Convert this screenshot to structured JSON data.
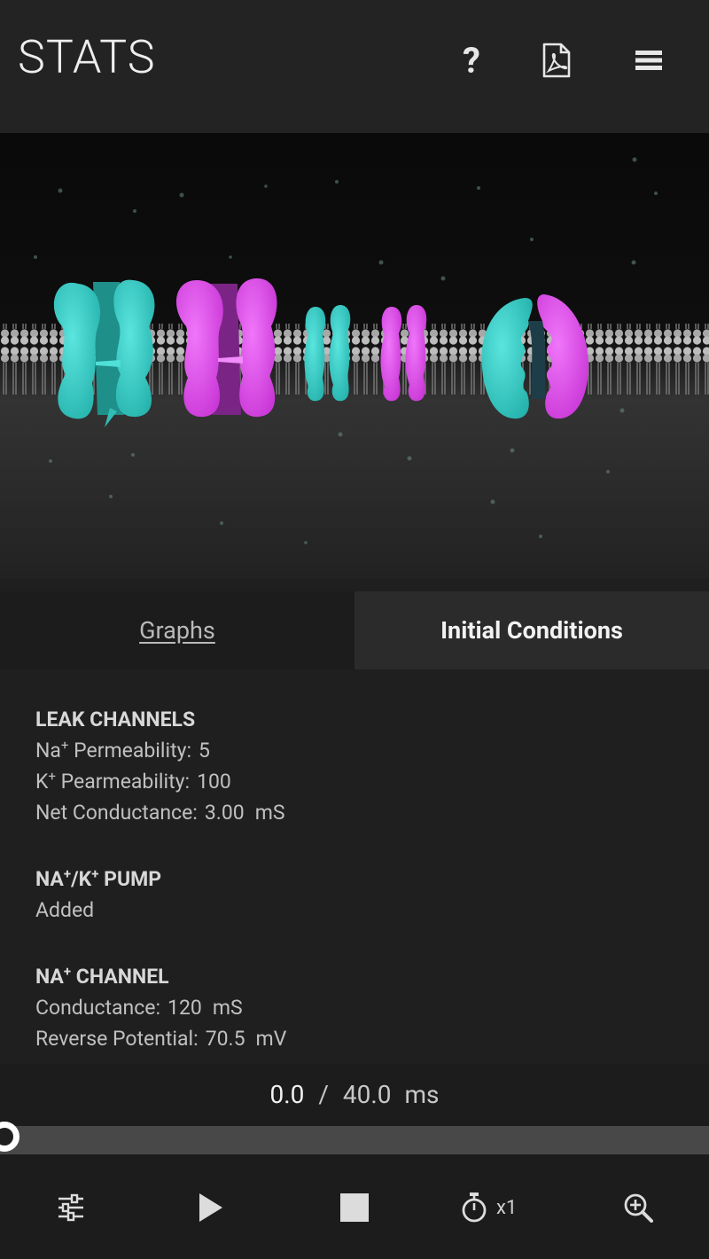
{
  "header": {
    "title": "STATS",
    "help_label": "?",
    "icons": [
      "help-icon",
      "pdf-icon",
      "menu-icon"
    ]
  },
  "tabs": [
    {
      "label": "Graphs",
      "active": false
    },
    {
      "label": "Initial Conditions",
      "active": true
    }
  ],
  "sections": {
    "leak": {
      "title": "LEAK CHANNELS",
      "na_label_pre": "Na",
      "na_label_sup": "+",
      "na_label_post": " Permeability:",
      "na_value": "5",
      "k_label_pre": "K",
      "k_label_sup": "+",
      "k_label_post": " Pearmeability:",
      "k_value": "100",
      "net_label": "Net Conductance:",
      "net_value": "3.00",
      "net_unit": "mS"
    },
    "pump": {
      "title_a": "NA",
      "title_sup1": "+",
      "title_b": "/K",
      "title_sup2": "+",
      "title_c": " PUMP",
      "status": "Added"
    },
    "na_channel": {
      "title_a": "NA",
      "title_sup": "+",
      "title_b": " CHANNEL",
      "conductance_label": "Conductance:",
      "conductance_value": "120",
      "conductance_unit": "mS",
      "reverse_label": "Reverse Potential:",
      "reverse_value": "70.5",
      "reverse_unit": "mV"
    }
  },
  "playback": {
    "current_time": "0.0",
    "separator": "/",
    "total_time": "40.0",
    "unit": "ms",
    "progress": 0.0,
    "speed_label": "x1"
  },
  "colors": {
    "cyan": "#3fd6d0",
    "magenta": "#e356ef",
    "background": "#1f1f1f",
    "header": "#232323"
  }
}
